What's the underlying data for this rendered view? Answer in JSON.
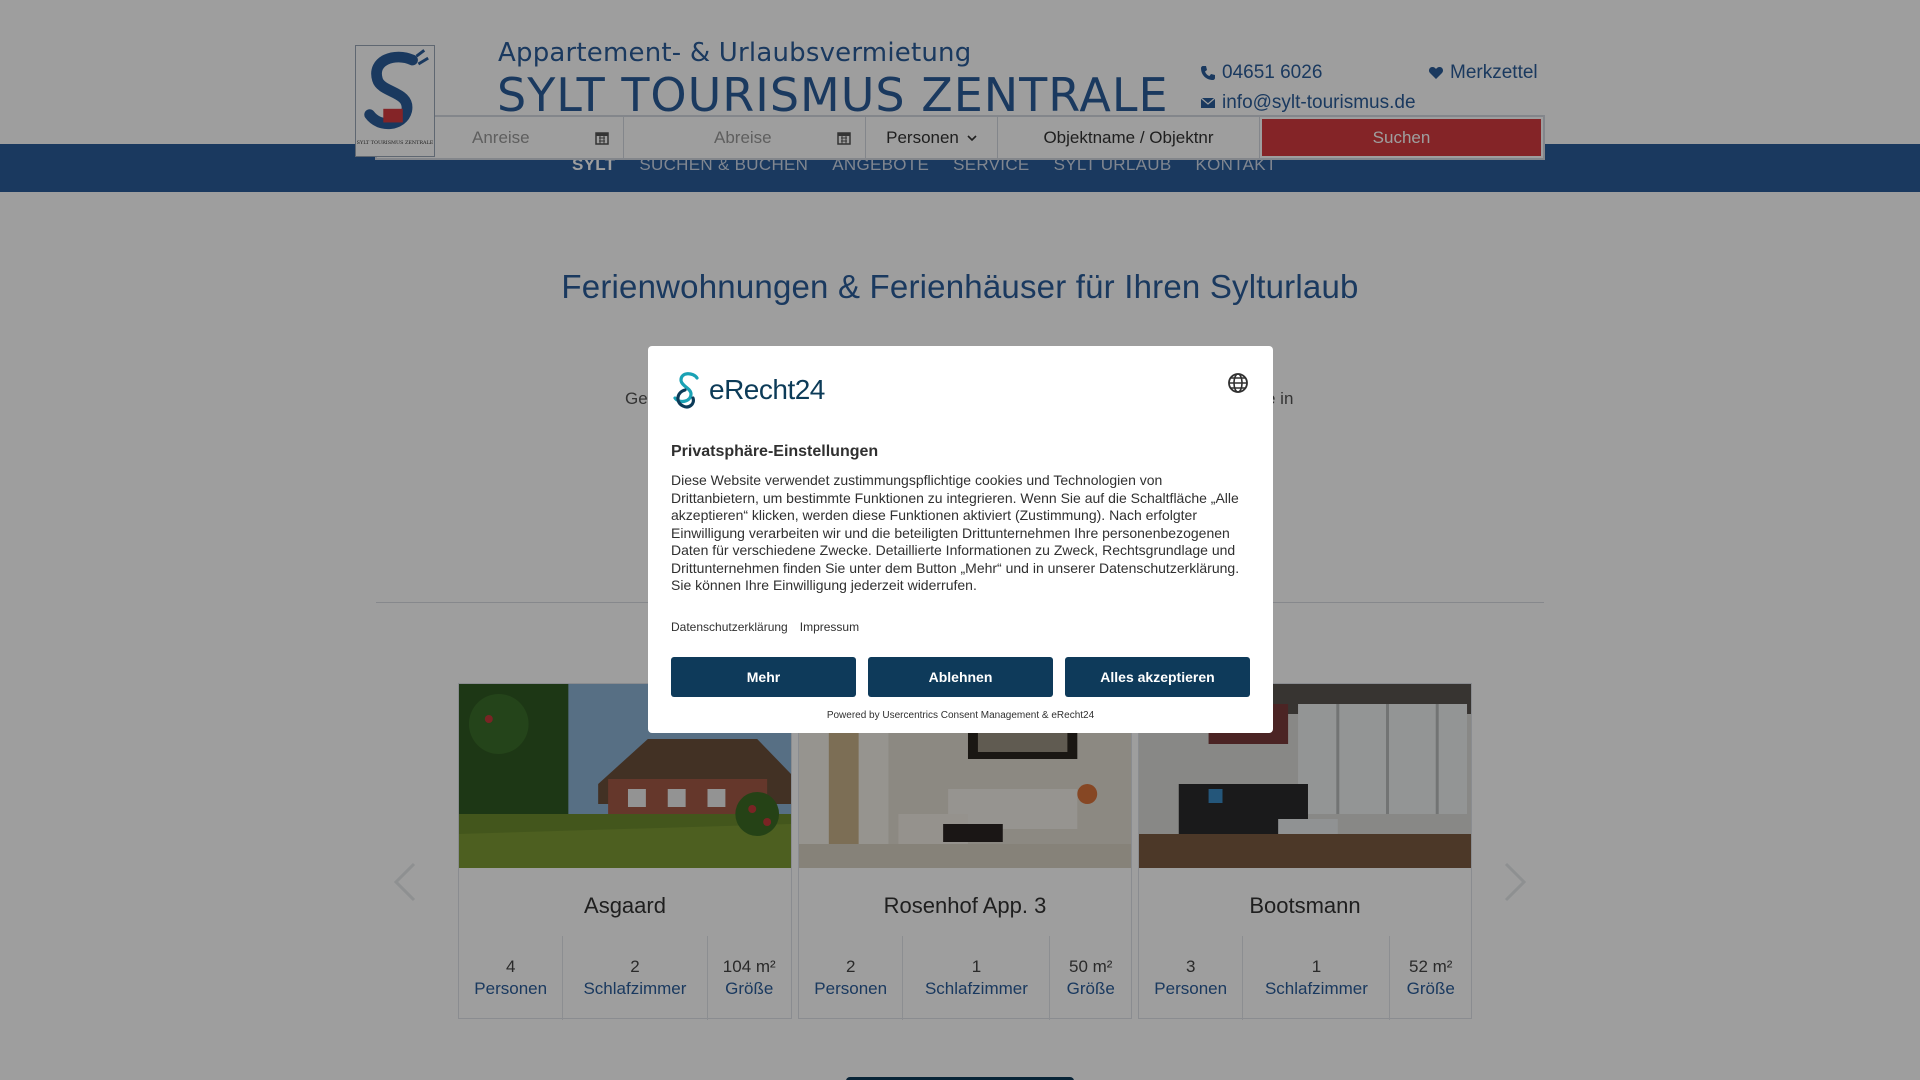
{
  "header": {
    "tagline": "Appartement- & Urlaubsvermietung",
    "brand": "SYLT TOURISMUS ZENTRALE",
    "logo_text": "SYLT TOURISMUS ZENTRALE",
    "phone": "04651 6026",
    "email": "info@sylt-tourismus.de",
    "merkzettel": "Merkzettel"
  },
  "search": {
    "arrival_placeholder": "Anreise",
    "departure_placeholder": "Abreise",
    "persons_label": "Personen",
    "object_placeholder": "Objektname / Objektnr",
    "submit_label": "Suchen"
  },
  "nav": {
    "items": [
      "SYLT",
      "SUCHEN & BUCHEN",
      "ANGEBOTE",
      "SERVICE",
      "SYLT URLAUB",
      "KONTAKT"
    ],
    "active": "SYLT"
  },
  "main": {
    "headline": "Ferienwohnungen & Ferienhäuser für Ihren Sylturlaub",
    "intro_left_fragment": "Ge",
    "intro_right_fragment": "e in"
  },
  "cards": [
    {
      "title": "Asgaard",
      "persons": "4",
      "persons_label": "Personen",
      "bedrooms": "2",
      "bedrooms_label": "Schlafzimmer",
      "size": "104 m²",
      "size_label": "Größe"
    },
    {
      "title": "Rosenhof App. 3",
      "persons": "2",
      "persons_label": "Personen",
      "bedrooms": "1",
      "bedrooms_label": "Schlafzimmer",
      "size": "50 m²",
      "size_label": "Größe"
    },
    {
      "title": "Bootsmann",
      "persons": "3",
      "persons_label": "Personen",
      "bedrooms": "1",
      "bedrooms_label": "Schlafzimmer",
      "size": "52 m²",
      "size_label": "Größe"
    }
  ],
  "consent": {
    "logo_text": "eRecht24",
    "title": "Privatsphäre-Einstellungen",
    "body": "Diese Website verwendet zustimmungspflichtige cookies und Technologien von Drittanbietern, um bestimmte Funktionen zu integrieren. Wenn Sie auf die Schaltfläche „Alle akzeptieren“ klicken, werden diese Funktionen aktiviert (Zustimmung). Nach erfolgter Einwilligung verarbeiten wir und die beteiligten Drittunternehmen Ihre personenbezogenen Daten für verschiedene Zwecke. Detaillierte Informationen zu Zweck, Rechtsgrundlage und Drittunternehmen finden Sie unter dem Button „Mehr“ und in unserer Datenschutzerklärung. Sie können Ihre Einwilligung jederzeit widerrufen.",
    "link_privacy": "Datenschutzerklärung",
    "link_imprint": "Impressum",
    "btn_more": "Mehr",
    "btn_decline": "Ablehnen",
    "btn_accept": "Alles akzeptieren",
    "powered_by": "Powered by Usercentrics Consent Management & eRecht24"
  },
  "colors": {
    "brand_blue": "#2a5c99",
    "search_red": "#d63a3f",
    "consent_navy": "#0e3a5a"
  }
}
